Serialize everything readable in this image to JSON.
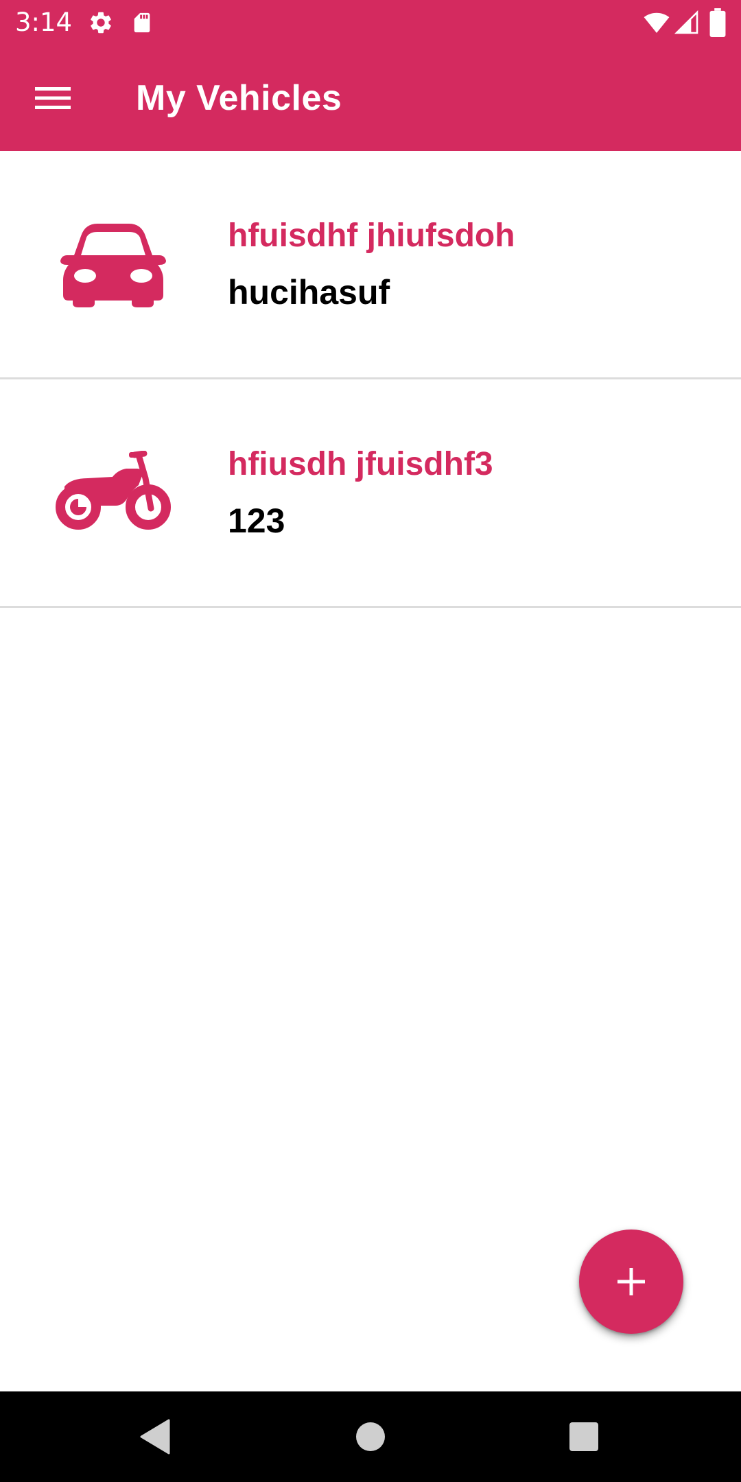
{
  "status_bar": {
    "time": "3:14",
    "icons": [
      "gear-icon",
      "sd-card-icon",
      "wifi-icon",
      "signal-icon",
      "battery-icon"
    ]
  },
  "app_bar": {
    "title": "My Vehicles",
    "menu_icon": "menu-icon"
  },
  "vehicles": [
    {
      "name": "hfuisdhf jhiufsdoh",
      "plate": "hucihasuf",
      "icon": "car-icon"
    },
    {
      "name": "hfiusdh jfuisdhf3",
      "plate": "123",
      "icon": "motorcycle-icon"
    }
  ],
  "fab": {
    "icon": "add-icon"
  },
  "nav_bar": {
    "icons": [
      "back-icon",
      "home-icon",
      "recents-icon"
    ]
  },
  "colors": {
    "primary": "#d42a5f",
    "divider": "#dcdcdc",
    "nav_bar": "#000000"
  }
}
